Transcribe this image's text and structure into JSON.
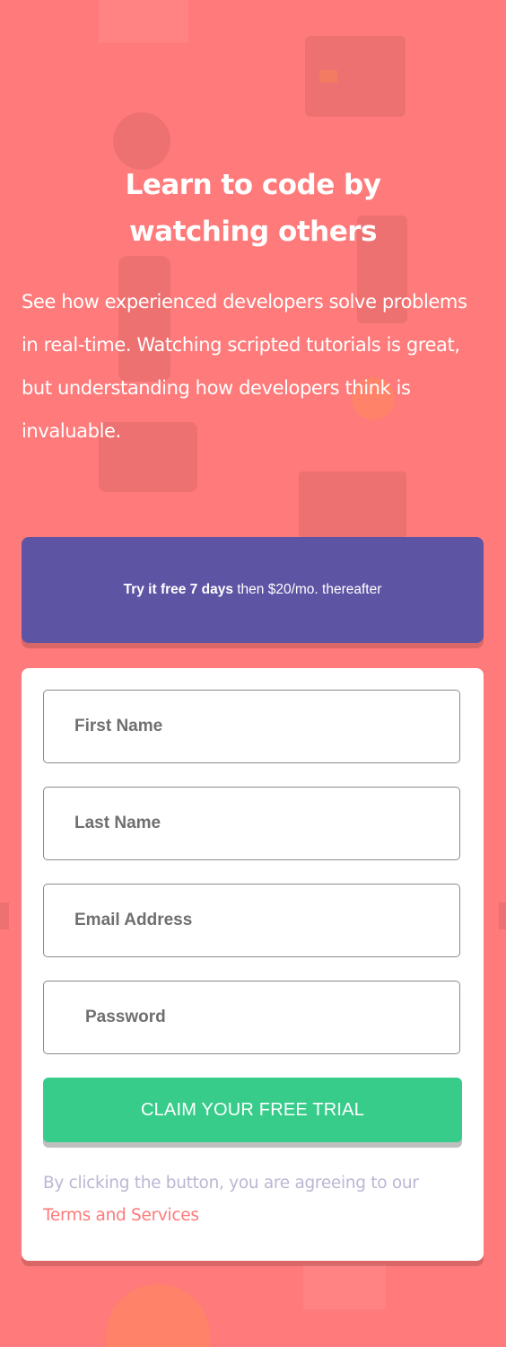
{
  "hero": {
    "title_line1": "Learn to code by",
    "title_line2": "watching others",
    "description": "See how experienced developers solve problems in real-time. Watching scripted tutorials is great, but understanding how developers think is invaluable."
  },
  "promo": {
    "bold_text": "Try it free 7 days",
    "rest_text": "then $20/mo. thereafter"
  },
  "form": {
    "first_name_placeholder": "First Name",
    "last_name_placeholder": "Last Name",
    "email_placeholder": "Email Address",
    "password_placeholder": "Password",
    "submit_label": "CLAIM YOUR FREE TRIAL",
    "terms_prefix": "By clicking the button, you are agreeing to our",
    "terms_link": "Terms and Services"
  },
  "colors": {
    "background": "#ff7a7a",
    "promo": "#5e54a4",
    "button": "#38cc8b",
    "terms_text": "#bab7d4",
    "terms_link": "#ff7979"
  }
}
